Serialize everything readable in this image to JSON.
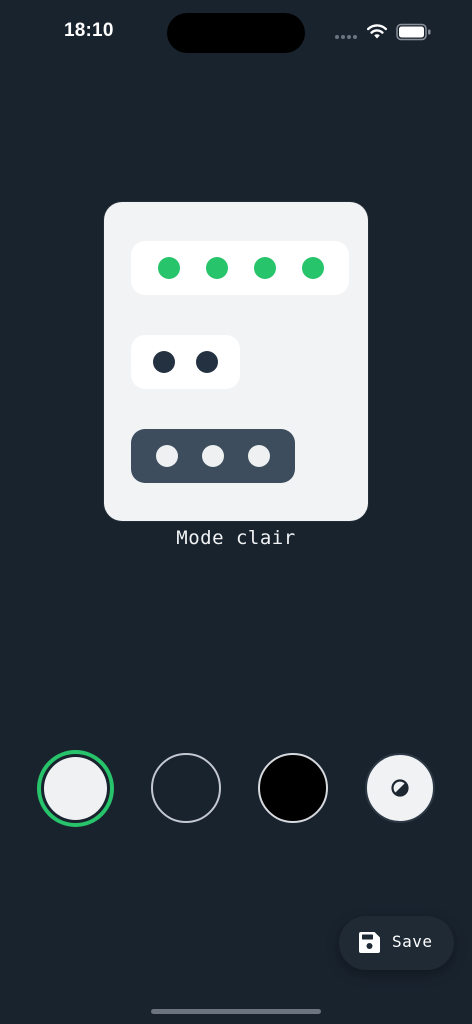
{
  "status_bar": {
    "time": "18:10",
    "icons": [
      "signal-icon",
      "wifi-icon",
      "battery-icon"
    ]
  },
  "preview": {
    "mode_label": "Mode clair",
    "top_row_dots": 4,
    "middle_row_dots": 2,
    "bottom_row_dots": 3,
    "colors": {
      "card_background": "#f2f3f5",
      "accent_green": "#27c46b",
      "dark_dot": "#243140",
      "bottom_pill": "#3d4d5e"
    }
  },
  "theme_options": {
    "items": [
      {
        "id": "light",
        "color": "#f0f1f3",
        "selected": true
      },
      {
        "id": "dark",
        "color": "#19232e",
        "selected": false
      },
      {
        "id": "black",
        "color": "#000000",
        "selected": false
      },
      {
        "id": "auto",
        "icon": "contrast-icon",
        "selected": false
      }
    ],
    "selected_ring_color": "#27c46b"
  },
  "actions": {
    "save_label": "Save",
    "save_icon": "floppy-disk-icon"
  },
  "colors": {
    "background": "#19232e"
  }
}
